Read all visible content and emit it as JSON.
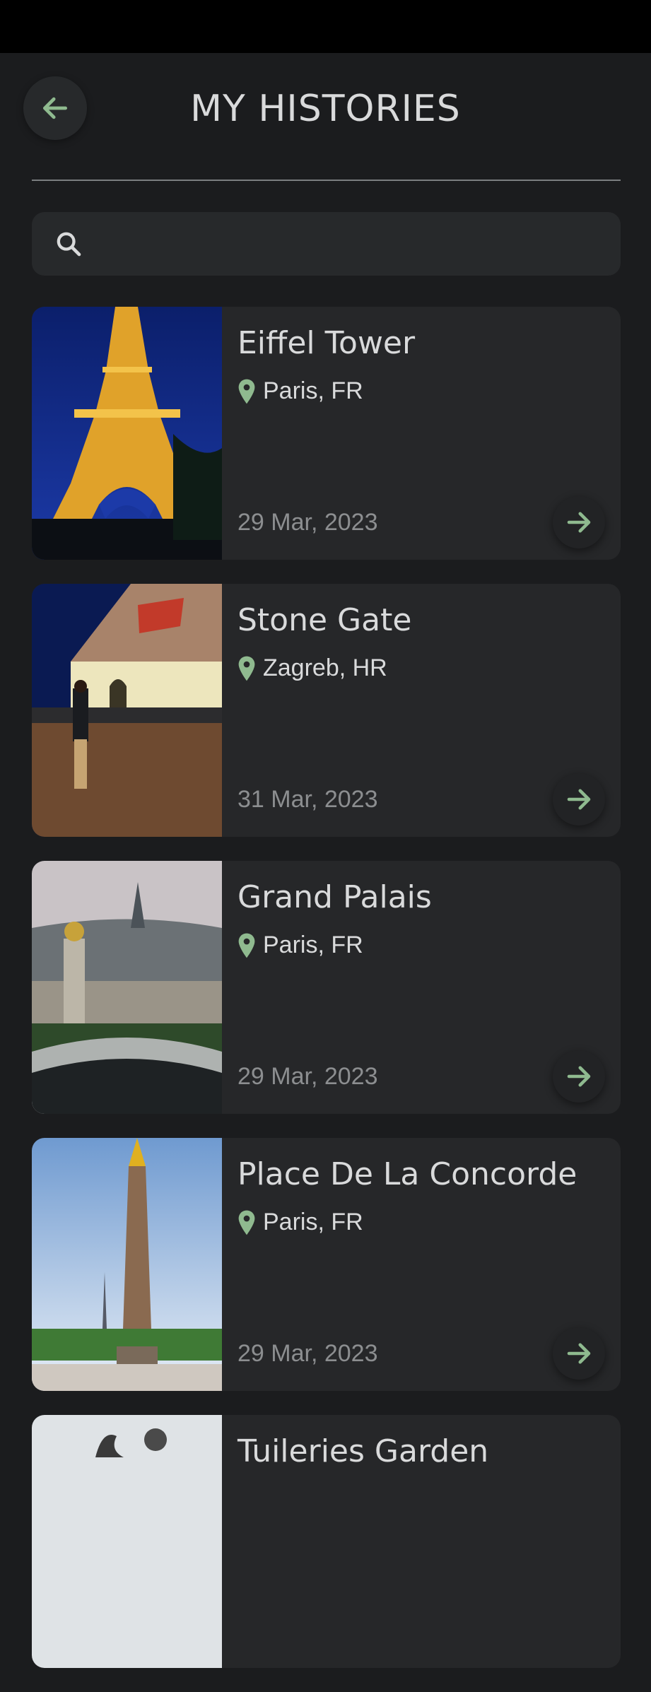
{
  "header": {
    "title": "MY HISTORIES",
    "back_icon": "arrow-left-icon"
  },
  "search": {
    "placeholder": "",
    "value": "",
    "icon": "search-icon"
  },
  "colors": {
    "accent": "#8fba8f",
    "background": "#1b1c1e",
    "card": "#262729",
    "text": "#d9dadb",
    "muted": "#8c8e90"
  },
  "histories": [
    {
      "title": "Eiffel Tower",
      "location": "Paris, FR",
      "date": "29 Mar, 2023"
    },
    {
      "title": "Stone Gate",
      "location": "Zagreb, HR",
      "date": "31 Mar, 2023"
    },
    {
      "title": "Grand Palais",
      "location": "Paris, FR",
      "date": "29 Mar, 2023"
    },
    {
      "title": "Place De La Concorde",
      "location": "Paris, FR",
      "date": "29 Mar, 2023"
    },
    {
      "title": "Tuileries Garden",
      "location": "",
      "date": ""
    }
  ]
}
